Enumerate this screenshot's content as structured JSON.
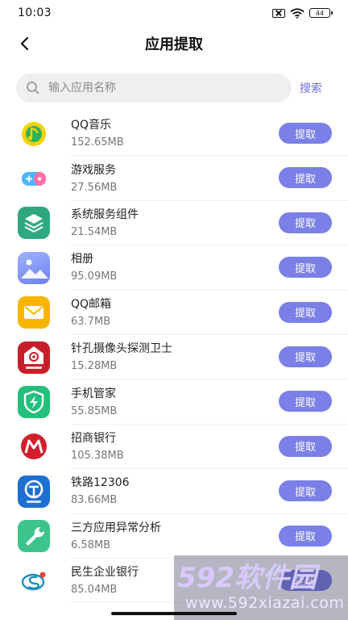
{
  "status_bar": {
    "time": "10:03",
    "battery": "44"
  },
  "header": {
    "title": "应用提取"
  },
  "search": {
    "placeholder": "输入应用名称",
    "button_label": "搜索"
  },
  "extract_label": "提取",
  "apps": [
    {
      "name": "QQ音乐",
      "size": "152.65MB",
      "icon": "qq-music-icon",
      "color": "#f5d200"
    },
    {
      "name": "游戏服务",
      "size": "27.56MB",
      "icon": "gamepad-icon",
      "color": "#4fb6ff"
    },
    {
      "name": "系统服务组件",
      "size": "21.54MB",
      "icon": "layers-icon",
      "color": "#2fa882"
    },
    {
      "name": "相册",
      "size": "95.09MB",
      "icon": "gallery-icon",
      "color": "#7f8cf2"
    },
    {
      "name": "QQ邮箱",
      "size": "63.7MB",
      "icon": "mail-icon",
      "color": "#f7b500"
    },
    {
      "name": "针孔摄像头探测卫士",
      "size": "15.28MB",
      "icon": "camera-detector-icon",
      "color": "#c81e2b"
    },
    {
      "name": "手机管家",
      "size": "55.85MB",
      "icon": "shield-bolt-icon",
      "color": "#22c07a"
    },
    {
      "name": "招商银行",
      "size": "105.38MB",
      "icon": "cmb-logo-icon",
      "color": "#d21e2b"
    },
    {
      "name": "铁路12306",
      "size": "83.66MB",
      "icon": "railway-icon",
      "color": "#1f6fd1"
    },
    {
      "name": "三方应用异常分析",
      "size": "6.58MB",
      "icon": "wrench-icon",
      "color": "#3cc48c"
    },
    {
      "name": "民生企业银行",
      "size": "85.04MB",
      "icon": "minsheng-logo-icon",
      "color": "#1a8fc0"
    }
  ],
  "watermark": {
    "brand": "592软件园",
    "url": "www.592xiazai.com"
  },
  "colors": {
    "accent": "#7a80e6",
    "search_link": "#6f72d6"
  }
}
